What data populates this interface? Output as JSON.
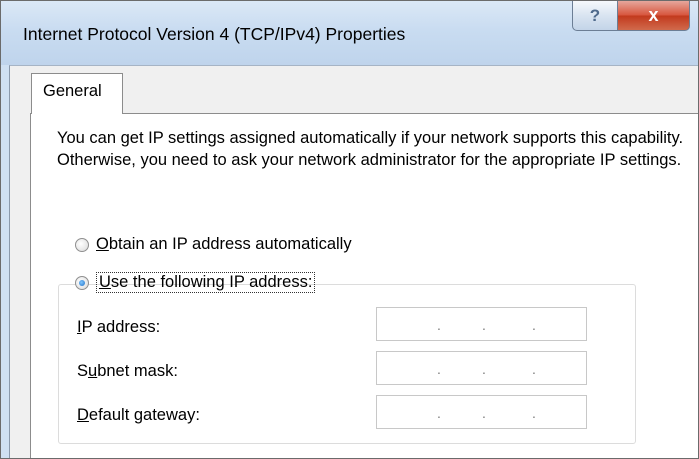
{
  "window": {
    "title": "Internet Protocol Version 4 (TCP/IPv4) Properties",
    "help_button": "?",
    "close_button": "x"
  },
  "tabs": [
    {
      "label": "General",
      "selected": true
    }
  ],
  "description": "You can get IP settings assigned automatically if your network supports this capability. Otherwise, you need to ask your network administrator for the appropriate IP settings.",
  "ip_mode": {
    "auto": {
      "mnemonic": "O",
      "rest": "btain an IP address automatically",
      "checked": false
    },
    "manual": {
      "mnemonic": "U",
      "rest": "se the following IP address:",
      "checked": true
    }
  },
  "fields": [
    {
      "pre": "",
      "mnemonic": "I",
      "post": "P address:",
      "value": ". . ."
    },
    {
      "pre": "S",
      "mnemonic": "u",
      "post": "bnet mask:",
      "value": ". . ."
    },
    {
      "pre": "",
      "mnemonic": "D",
      "post": "efault gateway:",
      "value": ". . ."
    }
  ]
}
